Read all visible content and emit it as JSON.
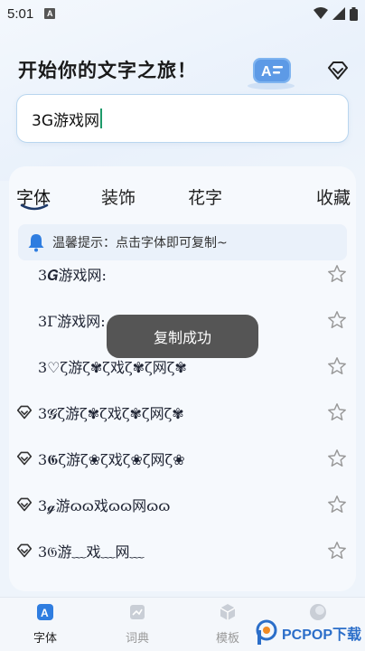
{
  "status_bar": {
    "time": "5:01",
    "app_icon": "A"
  },
  "header": {
    "title": "开始你的文字之旅！",
    "brand_badge_text": "A"
  },
  "input": {
    "value": "3G游戏网"
  },
  "tabs": [
    {
      "label": "字体",
      "active": true
    },
    {
      "label": "装饰",
      "active": false
    },
    {
      "label": "花字",
      "active": false
    },
    {
      "label": "收藏",
      "active": false
    }
  ],
  "tip": {
    "text": "温馨提示：点击字体即可复制~"
  },
  "font_rows": [
    {
      "text": "3𝑮游戏网:",
      "vip": false
    },
    {
      "text": "3Γ游戏网:",
      "vip": false
    },
    {
      "text": "3♡ζ游ζ✾ζ戏ζ✾ζ网ζ✾",
      "vip": false
    },
    {
      "text": "3𝓖ζ游ζ✾ζ戏ζ✾ζ网ζ✾",
      "vip": true
    },
    {
      "text": "3𝕲ζ游ζ❀ζ戏ζ❀ζ网ζ❀",
      "vip": true
    },
    {
      "text": "3𝓰游ɷɷ戏ɷɷ网ɷɷ",
      "vip": true
    },
    {
      "text": "3𝔊游﹏戏﹏网﹏",
      "vip": true
    }
  ],
  "toast": {
    "text": "复制成功"
  },
  "bottom_nav": [
    {
      "label": "字体",
      "active": true
    },
    {
      "label": "词典",
      "active": false
    },
    {
      "label": "模板",
      "active": false
    },
    {
      "label": "",
      "active": false
    }
  ],
  "watermark": {
    "text": "PCPOP下载"
  },
  "colors": {
    "accent": "#2f7de0",
    "tab_underline": "#1e3a6a",
    "toast_bg": "#464646"
  }
}
